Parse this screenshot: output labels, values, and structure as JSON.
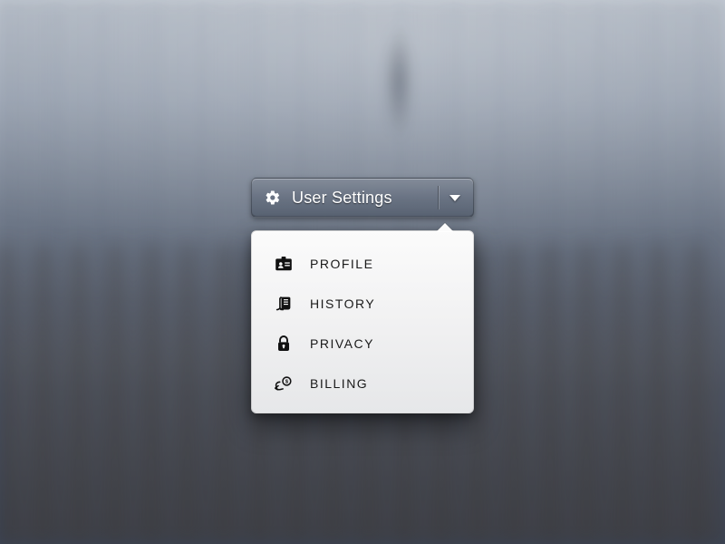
{
  "dropdown": {
    "label": "User Settings",
    "items": [
      {
        "icon": "profile-icon",
        "label": "PROFILE"
      },
      {
        "icon": "history-icon",
        "label": "HISTORY"
      },
      {
        "icon": "privacy-icon",
        "label": "PRIVACY"
      },
      {
        "icon": "billing-icon",
        "label": "BILLING"
      }
    ]
  }
}
